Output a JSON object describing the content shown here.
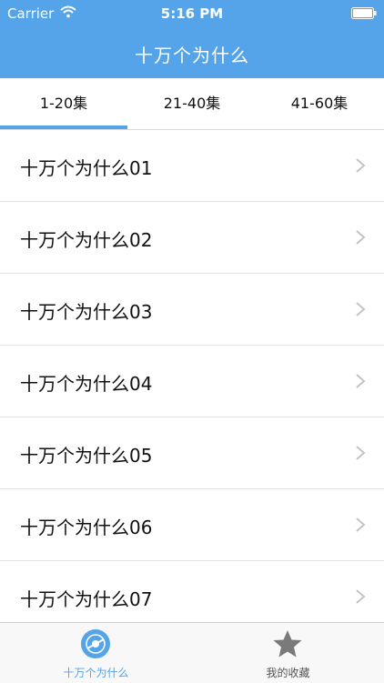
{
  "status": {
    "carrier": "Carrier",
    "time": "5:16 PM"
  },
  "nav": {
    "title": "十万个为什么"
  },
  "tabs": [
    {
      "label": "1-20集"
    },
    {
      "label": "21-40集"
    },
    {
      "label": "41-60集"
    }
  ],
  "selected_tab": "1-20集",
  "list": [
    {
      "title": "十万个为什么01"
    },
    {
      "title": "十万个为什么02"
    },
    {
      "title": "十万个为什么03"
    },
    {
      "title": "十万个为什么04"
    },
    {
      "title": "十万个为什么05"
    },
    {
      "title": "十万个为什么06"
    },
    {
      "title": "十万个为什么07"
    }
  ],
  "tabbar": [
    {
      "label": "十万个为什么",
      "icon": "disc-icon"
    },
    {
      "label": "我的收藏",
      "icon": "star-icon"
    }
  ],
  "colors": {
    "accent": "#55a3e8",
    "inactive": "#777777"
  }
}
